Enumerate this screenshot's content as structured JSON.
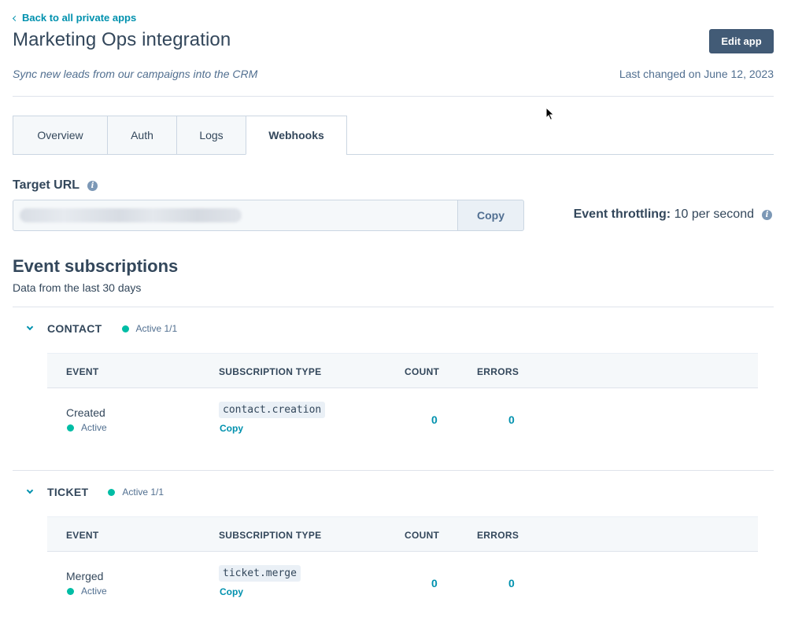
{
  "nav": {
    "back_label": "Back to all private apps"
  },
  "header": {
    "title": "Marketing Ops integration",
    "edit_button": "Edit app",
    "description": "Sync new leads from our campaigns into the CRM",
    "last_changed": "Last changed on June 12, 2023"
  },
  "tabs": [
    {
      "label": "Overview"
    },
    {
      "label": "Auth"
    },
    {
      "label": "Logs"
    },
    {
      "label": "Webhooks",
      "active": true
    }
  ],
  "target_url": {
    "label": "Target URL",
    "info_icon": "info-icon",
    "copy_label": "Copy"
  },
  "throttling": {
    "label": "Event throttling:",
    "value": "10 per second"
  },
  "subscriptions": {
    "title": "Event subscriptions",
    "subtitle": "Data from the last 30 days",
    "columns": [
      "EVENT",
      "SUBSCRIPTION TYPE",
      "COUNT",
      "ERRORS"
    ],
    "groups": [
      {
        "name": "CONTACT",
        "status": "Active 1/1",
        "rows": [
          {
            "event": "Created",
            "status": "Active",
            "subscription_type": "contact.creation",
            "copy_label": "Copy",
            "count": "0",
            "errors": "0"
          }
        ]
      },
      {
        "name": "TICKET",
        "status": "Active 1/1",
        "rows": [
          {
            "event": "Merged",
            "status": "Active",
            "subscription_type": "ticket.merge",
            "copy_label": "Copy",
            "count": "0",
            "errors": "0"
          }
        ]
      }
    ]
  },
  "colors": {
    "accent": "#0091ae",
    "primary_button": "#425b76",
    "active_status": "#00bda5",
    "text": "#33475b"
  }
}
